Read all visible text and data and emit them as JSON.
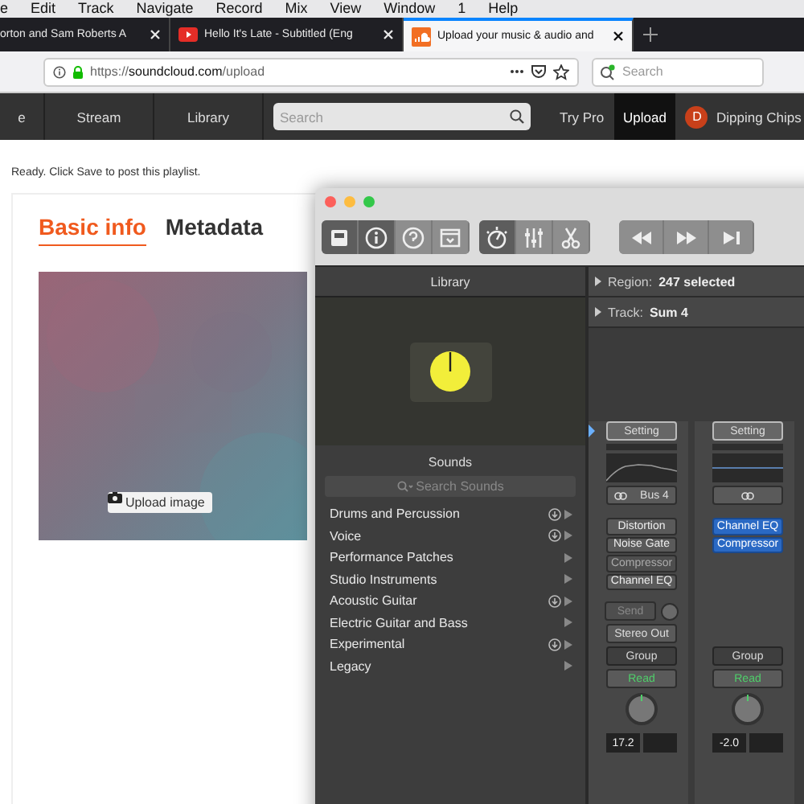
{
  "menubar": [
    "e",
    "Edit",
    "Track",
    "Navigate",
    "Record",
    "Mix",
    "View",
    "Window",
    "1",
    "Help"
  ],
  "browser_tabs": [
    {
      "title": "orton and Sam Roberts A",
      "kind": "plain",
      "selected": false
    },
    {
      "title": "Hello It's Late - Subtitled (Eng",
      "kind": "video",
      "selected": false
    },
    {
      "title": "Upload your music & audio and",
      "kind": "cloud",
      "selected": true
    }
  ],
  "address": {
    "scheme": "https://",
    "host": "soundcloud.com",
    "path": "/upload"
  },
  "browser_search": {
    "placeholder": "Search"
  },
  "site_nav": {
    "left": [
      "e",
      "Stream",
      "Library"
    ],
    "search_placeholder": "Search",
    "right": [
      {
        "label": "Try Pro",
        "selected": false
      },
      {
        "label": "Upload",
        "selected": true
      }
    ],
    "user": {
      "initial": "D",
      "name": "Dipping Chips"
    }
  },
  "status": "Ready. Click Save to post this playlist.",
  "form_tabs": [
    {
      "label": "Basic info",
      "selected": true
    },
    {
      "label": "Metadata",
      "selected": false
    }
  ],
  "artwork": {
    "kind": "picture",
    "button": "Upload image"
  },
  "logic": {
    "toolbar": [
      [
        {
          "kind": "library",
          "selected": true
        },
        {
          "kind": "info",
          "selected": true
        },
        {
          "kind": "help",
          "selected": false
        },
        {
          "kind": "editor",
          "selected": false
        }
      ],
      [
        {
          "kind": "tuner",
          "selected": true
        },
        {
          "kind": "mixer",
          "selected": false
        },
        {
          "kind": "scissors",
          "selected": false
        }
      ],
      [
        {
          "kind": "rewind",
          "selected": false
        },
        {
          "kind": "forward",
          "selected": false
        },
        {
          "kind": "end",
          "selected": false
        }
      ]
    ],
    "library": {
      "title": "Library",
      "sounds_title": "Sounds",
      "search_placeholder": "Search Sounds",
      "items": [
        {
          "label": "Drums and Percussion",
          "download": true
        },
        {
          "label": "Voice",
          "download": true
        },
        {
          "label": "Performance Patches",
          "download": false
        },
        {
          "label": "Studio Instruments",
          "download": false
        },
        {
          "label": "Acoustic Guitar",
          "download": true
        },
        {
          "label": "Electric Guitar and Bass",
          "download": false
        },
        {
          "label": "Experimental",
          "download": true
        },
        {
          "label": "Legacy",
          "download": false
        }
      ]
    },
    "inspector": {
      "region": {
        "label": "Region:",
        "value": "247 selected"
      },
      "track": {
        "label": "Track:",
        "value": "Sum 4"
      }
    },
    "strips": [
      {
        "setting": "Setting",
        "bus": "Bus 4",
        "plugins": [
          {
            "name": "Distortion",
            "bypassed": false,
            "selected": false
          },
          {
            "name": "Noise Gate",
            "bypassed": false,
            "selected": false
          },
          {
            "name": "Compressor",
            "bypassed": true,
            "selected": false
          },
          {
            "name": "Channel EQ",
            "bypassed": false,
            "selected": false
          }
        ],
        "send": "Send",
        "output": "Stereo Out",
        "group": "Group",
        "automation": "Read",
        "volume": "17.2"
      },
      {
        "setting": "Setting",
        "plugins": [
          {
            "name": "Channel EQ",
            "bypassed": false,
            "selected": true
          },
          {
            "name": "Compressor",
            "bypassed": false,
            "selected": true
          }
        ],
        "group": "Group",
        "automation": "Read",
        "volume": "-2.0"
      }
    ]
  }
}
